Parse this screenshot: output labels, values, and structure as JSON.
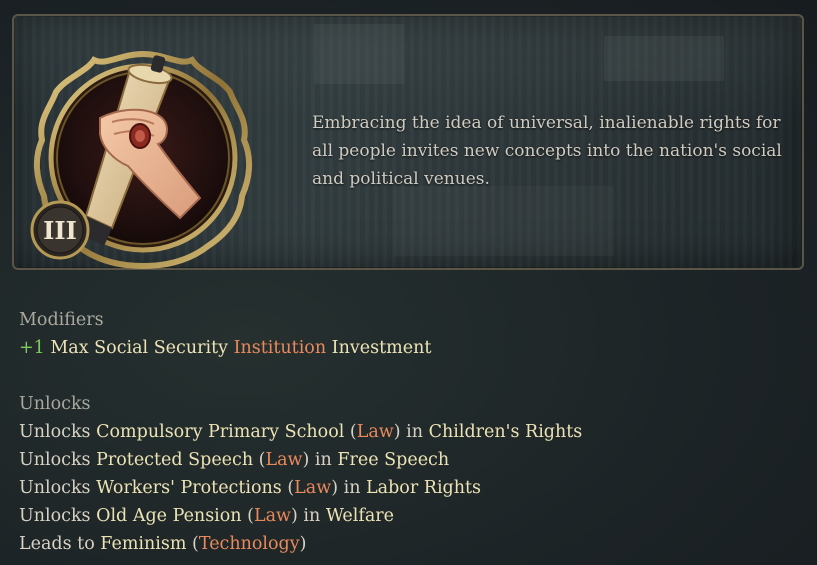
{
  "header": {
    "tier_badge": "III",
    "icon": "scroll-hand-icon",
    "description": "Embracing the idea of universal, inalienable rights for all people invites new concepts into the nation's social and political venues."
  },
  "modifiers": {
    "title": "Modifiers",
    "items": [
      {
        "value": "+1",
        "text_a": "Max Social Security ",
        "link": "Institution",
        "text_b": " Investment"
      }
    ]
  },
  "unlocks": {
    "title": "Unlocks",
    "items": [
      {
        "prefix": "Unlocks ",
        "name": "Compulsory Primary School",
        "open": " (",
        "type": "Law",
        "close": ") in ",
        "target": "Children's Rights"
      },
      {
        "prefix": "Unlocks ",
        "name": "Protected Speech",
        "open": " (",
        "type": "Law",
        "close": ") in ",
        "target": "Free Speech"
      },
      {
        "prefix": "Unlocks ",
        "name": "Workers' Protections",
        "open": " (",
        "type": "Law",
        "close": ") in ",
        "target": "Labor Rights"
      },
      {
        "prefix": "Unlocks ",
        "name": "Old Age Pension",
        "open": " (",
        "type": "Law",
        "close": ") in ",
        "target": "Welfare"
      }
    ],
    "leads": {
      "prefix": "Leads to ",
      "name": "Feminism",
      "open": " (",
      "type": "Technology",
      "close": ")"
    }
  },
  "colors": {
    "highlight": "#ece3b5",
    "link": "#e9895c",
    "positive": "#7ccc5a",
    "section": "#a9a89f",
    "frame_gold": "#b59a55"
  }
}
